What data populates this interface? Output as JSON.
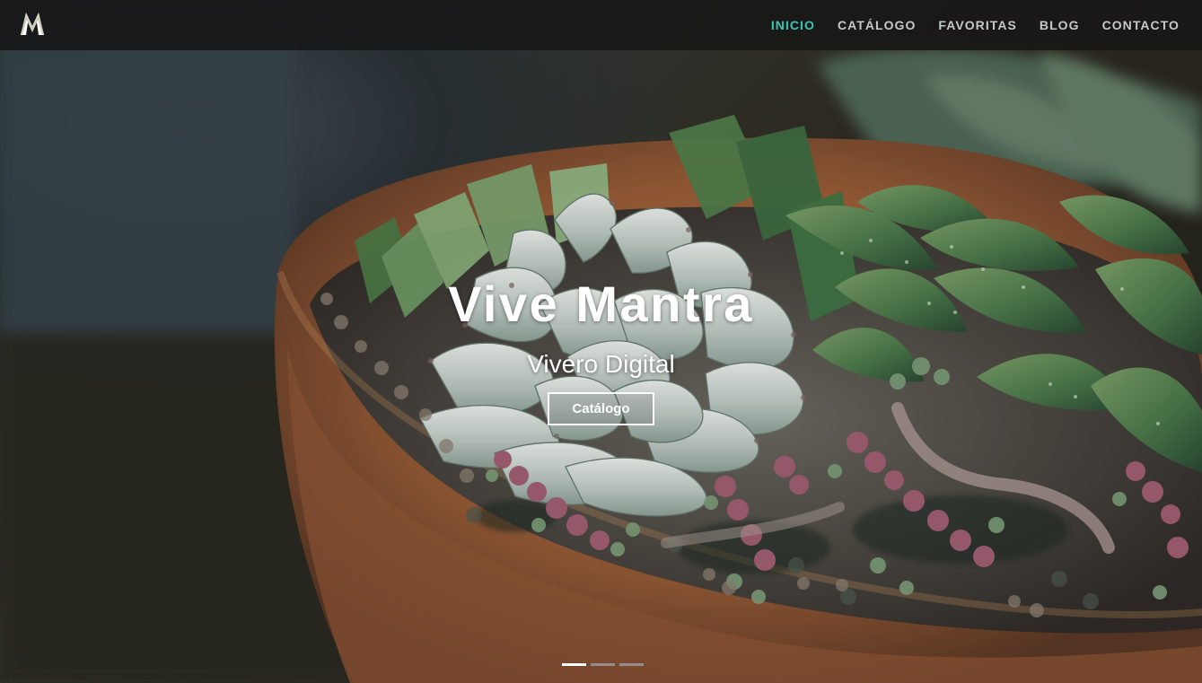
{
  "navigation": {
    "brand_icon": "m-logo-icon",
    "items": [
      {
        "label": "INICIO",
        "active": true
      },
      {
        "label": "CATÁLOGO",
        "active": false
      },
      {
        "label": "FAVORITAS",
        "active": false
      },
      {
        "label": "BLOG",
        "active": false
      },
      {
        "label": "CONTACTO",
        "active": false
      }
    ],
    "active_color": "#39c7b6",
    "text_color": "#c7c9c9",
    "background_color": "#161616"
  },
  "hero": {
    "title": "Vive Mantra",
    "subtitle": "Vivero Digital",
    "button_label": "Catálogo",
    "image_description": "",
    "slide_indicators": [
      {
        "active": true
      },
      {
        "active": false
      },
      {
        "active": false
      }
    ]
  }
}
